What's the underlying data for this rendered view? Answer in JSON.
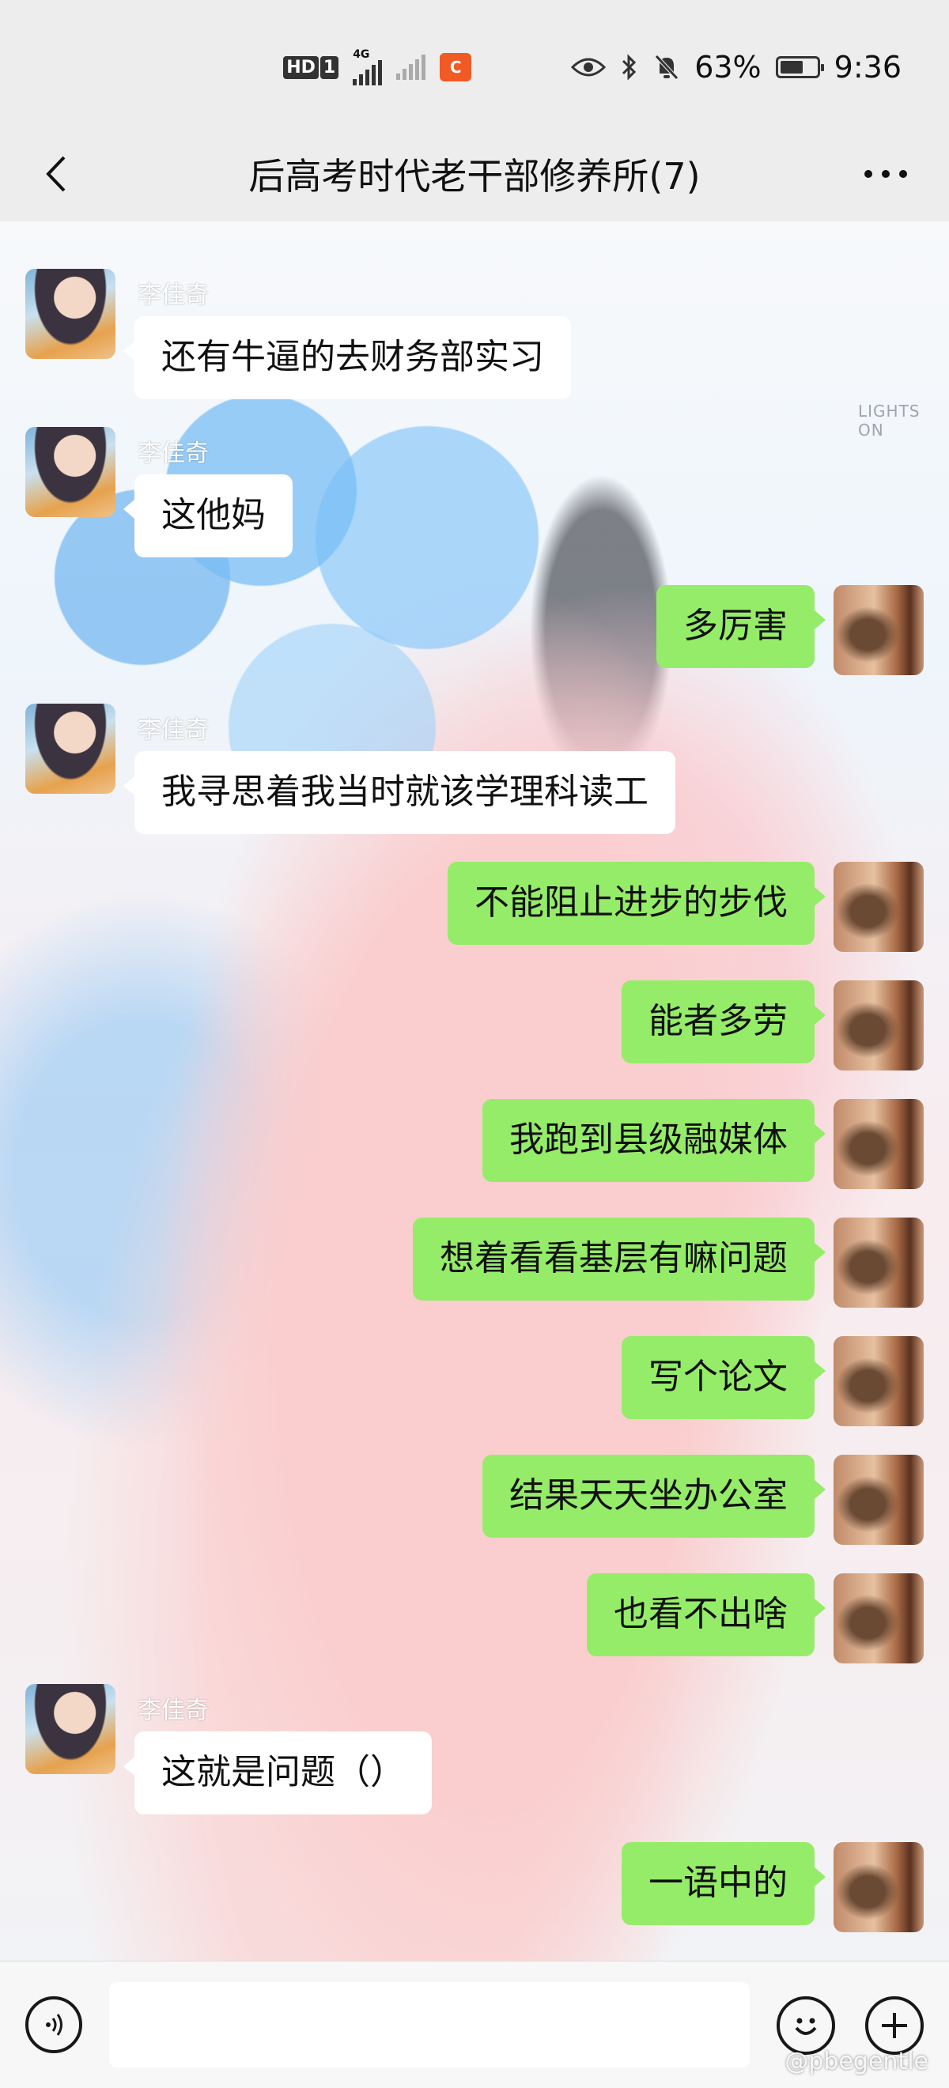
{
  "status_bar": {
    "hd_label": "HD",
    "sim_label": "1",
    "network_label": "4G",
    "app_badge": "C",
    "battery_percent": "63%",
    "battery_level": 0.63,
    "time": "9:36",
    "icons": [
      "eye-icon",
      "bluetooth-icon",
      "bell-muted-icon",
      "battery-icon"
    ]
  },
  "header": {
    "title": "后高考时代老干部修养所(7)",
    "back_icon": "chevron-left-icon",
    "more_icon": "more-dots-icon"
  },
  "background_text": {
    "lights_on": "LIGHTS ON"
  },
  "messages": [
    {
      "side": "left",
      "sender": "李佳奇",
      "text": "还有牛逼的去财务部实习"
    },
    {
      "side": "left",
      "sender": "李佳奇",
      "text": "这他妈"
    },
    {
      "side": "right",
      "text": "多厉害"
    },
    {
      "side": "left",
      "sender": "李佳奇",
      "text": "我寻思着我当时就该学理科读工"
    },
    {
      "side": "right",
      "text": "不能阻止进步的步伐"
    },
    {
      "side": "right",
      "text": "能者多劳"
    },
    {
      "side": "right",
      "text": "我跑到县级融媒体"
    },
    {
      "side": "right",
      "text": "想着看看基层有嘛问题"
    },
    {
      "side": "right",
      "text": "写个论文"
    },
    {
      "side": "right",
      "text": "结果天天坐办公室"
    },
    {
      "side": "right",
      "text": "也看不出啥"
    },
    {
      "side": "left",
      "sender": "李佳奇",
      "text": "这就是问题（）"
    },
    {
      "side": "right",
      "text": "一语中的"
    }
  ],
  "input_bar": {
    "value": "",
    "voice_icon": "voice-icon",
    "emoji_icon": "emoji-icon",
    "plus_icon": "plus-icon"
  },
  "watermark": "@pbegentle",
  "colors": {
    "self_bubble": "#95ec69",
    "other_bubble": "#ffffff",
    "bar_background": "#ededed"
  }
}
